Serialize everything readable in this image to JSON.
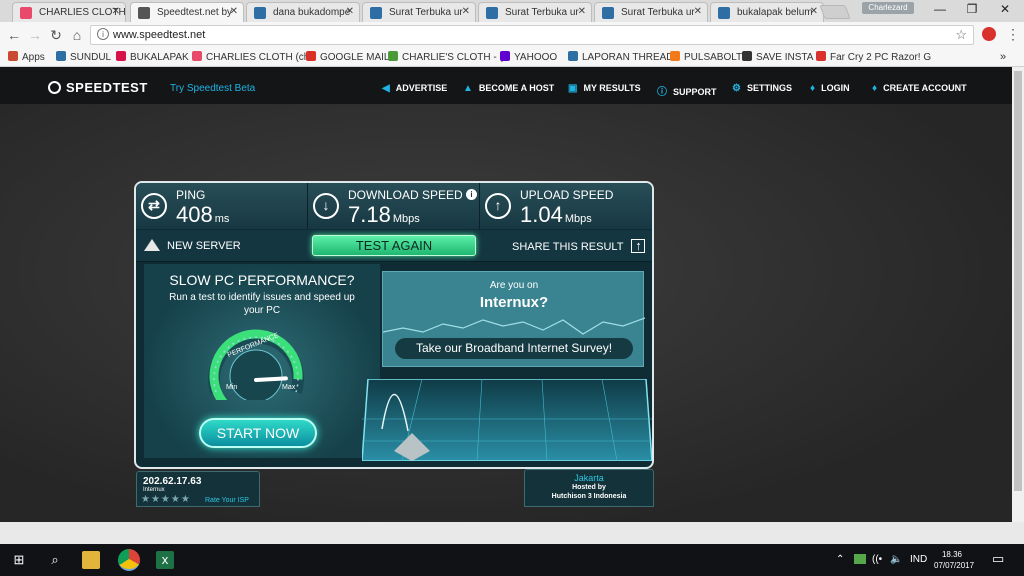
{
  "browser": {
    "tabs": [
      {
        "title": "CHARLIES CLOTH",
        "color": "#e94a6a"
      },
      {
        "title": "Speedtest.net by",
        "color": "#555555"
      },
      {
        "title": "dana bukadompe",
        "color": "#2f6ea5"
      },
      {
        "title": "Surat Terbuka ur",
        "color": "#2f6ea5"
      },
      {
        "title": "Surat Terbuka ur",
        "color": "#2f6ea5"
      },
      {
        "title": "Surat Terbuka ur",
        "color": "#2f6ea5"
      },
      {
        "title": "bukalapak belum",
        "color": "#2f6ea5"
      }
    ],
    "profile_name": "Charlezard",
    "url": "www.speedtest.net",
    "extension_badge": "24",
    "bookmarks": [
      {
        "label": "Apps",
        "color": "#c84b31"
      },
      {
        "label": "SUNDUL",
        "color": "#2f6ea5"
      },
      {
        "label": "BUKALAPAK",
        "color": "#d71149"
      },
      {
        "label": "CHARLIES CLOTH (ch",
        "color": "#e94a6a"
      },
      {
        "label": "GOOGLE MAIL",
        "color": "#d93025"
      },
      {
        "label": "CHARLIE'S CLOTH - (",
        "color": "#4a9a3a"
      },
      {
        "label": "YAHOOO",
        "color": "#6001d2"
      },
      {
        "label": "LAPORAN THREAD",
        "color": "#2f6ea5"
      },
      {
        "label": "PULSABOLT",
        "color": "#f27a1a"
      },
      {
        "label": "SAVE INSTA",
        "color": "#333333"
      },
      {
        "label": "Far Cry 2 PC Razor! G",
        "color": "#d9312b"
      }
    ]
  },
  "site": {
    "logo": "SPEEDTEST",
    "beta_link": "Try Speedtest Beta",
    "nav": [
      "ADVERTISE",
      "BECOME A HOST",
      "MY RESULTS",
      "SUPPORT",
      "SETTINGS",
      "LOGIN",
      "CREATE ACCOUNT"
    ]
  },
  "results": {
    "ping": {
      "label": "PING",
      "value": "408",
      "unit": "ms"
    },
    "download": {
      "label": "DOWNLOAD SPEED",
      "value": "7.18",
      "unit": "Mbps"
    },
    "upload": {
      "label": "UPLOAD SPEED",
      "value": "1.04",
      "unit": "Mbps"
    },
    "new_server": "NEW SERVER",
    "test_again": "TEST AGAIN",
    "share": "SHARE THIS RESULT"
  },
  "ad_pc": {
    "title": "SLOW PC PERFORMANCE?",
    "subtitle": "Run a test to identify issues and speed up your PC",
    "gauge_label": "PERFORMANCE",
    "gauge_min": "Min",
    "gauge_max": "Max",
    "gauge_level": 0.85,
    "button": "START NOW"
  },
  "ad_survey": {
    "question": "Are you on",
    "isp": "Internux?",
    "button": "Take our Broadband Internet Survey!"
  },
  "client": {
    "ip": "202.62.17.63",
    "isp": "Internux",
    "rate_label": "Rate Your ISP",
    "stars": "★★★★★"
  },
  "server": {
    "city": "Jakarta",
    "hosted_by": "Hosted by",
    "host": "Hutchison 3 Indonesia"
  },
  "taskbar": {
    "language": "IND",
    "time": "18.36",
    "date": "07/07/2017"
  }
}
